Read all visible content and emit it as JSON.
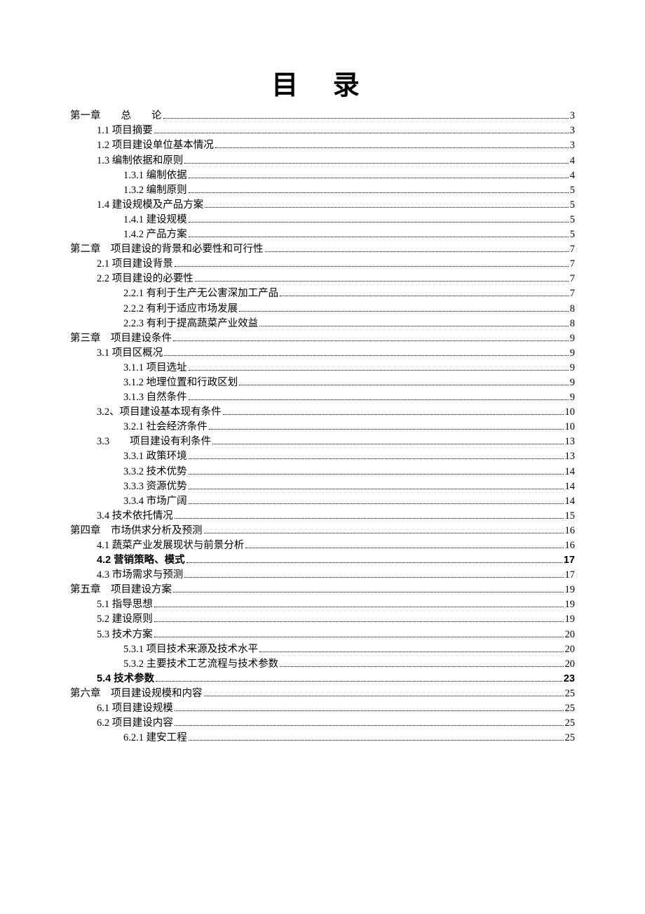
{
  "title": "目  录",
  "entries": [
    {
      "level": 1,
      "label": "第一章　　总　　论",
      "page": "3",
      "bold": false
    },
    {
      "level": 2,
      "label": "1.1 项目摘要",
      "page": "3",
      "bold": false
    },
    {
      "level": 2,
      "label": "1.2 项目建设单位基本情况",
      "page": "3",
      "bold": false
    },
    {
      "level": 2,
      "label": "1.3 编制依据和原则",
      "page": "4",
      "bold": false
    },
    {
      "level": 3,
      "label": "1.3.1 编制依据",
      "page": "4",
      "bold": false
    },
    {
      "level": 3,
      "label": "1.3.2 编制原则",
      "page": "5",
      "bold": false
    },
    {
      "level": 2,
      "label": "1.4 建设规模及产品方案",
      "page": "5",
      "bold": false
    },
    {
      "level": 3,
      "label": "1.4.1 建设规模",
      "page": "5",
      "bold": false
    },
    {
      "level": 3,
      "label": "1.4.2 产品方案",
      "page": "5",
      "bold": false
    },
    {
      "level": 1,
      "label": "第二章　项目建设的背景和必要性和可行性",
      "page": "7",
      "bold": false
    },
    {
      "level": 2,
      "label": "2.1 项目建设背景",
      "page": "7",
      "bold": false
    },
    {
      "level": 2,
      "label": "2.2 项目建设的必要性",
      "page": "7",
      "bold": false
    },
    {
      "level": 3,
      "label": "2.2.1 有利于生产无公害深加工产品",
      "page": "7",
      "bold": false
    },
    {
      "level": 3,
      "label": "2.2.2 有利于适应市场发展",
      "page": "8",
      "bold": false
    },
    {
      "level": 3,
      "label": "2.2.3 有利于提高蔬菜产业效益",
      "page": "8",
      "bold": false
    },
    {
      "level": 1,
      "label": "第三章　项目建设条件",
      "page": "9",
      "bold": false
    },
    {
      "level": 2,
      "label": "3.1 项目区概况",
      "page": "9",
      "bold": false
    },
    {
      "level": 3,
      "label": "3.1.1 项目选址",
      "page": "9",
      "bold": false
    },
    {
      "level": 3,
      "label": "3.1.2 地理位置和行政区划",
      "page": "9",
      "bold": false
    },
    {
      "level": 3,
      "label": "3.1.3 自然条件",
      "page": "9",
      "bold": false
    },
    {
      "level": 2,
      "label": "3.2、项目建设基本现有条件",
      "page": "10",
      "bold": false
    },
    {
      "level": 3,
      "label": "3.2.1 社会经济条件",
      "page": "10",
      "bold": false
    },
    {
      "level": 2,
      "label": "3.3　　项目建设有利条件",
      "page": "13",
      "bold": false
    },
    {
      "level": 3,
      "label": "3.3.1 政策环境",
      "page": "13",
      "bold": false
    },
    {
      "level": 3,
      "label": "3.3.2 技术优势",
      "page": "14",
      "bold": false
    },
    {
      "level": 3,
      "label": "3.3.3 资源优势",
      "page": "14",
      "bold": false
    },
    {
      "level": 3,
      "label": "3.3.4 市场广阔",
      "page": "14",
      "bold": false
    },
    {
      "level": 2,
      "label": "3.4 技术依托情况",
      "page": "15",
      "bold": false
    },
    {
      "level": 1,
      "label": "第四章　市场供求分析及预测",
      "page": "16",
      "bold": false
    },
    {
      "level": 2,
      "label": "4.1 蔬菜产业发展现状与前景分析",
      "page": "16",
      "bold": false
    },
    {
      "level": 2,
      "label": "4.2 营销策略、模式",
      "page": "17",
      "bold": true
    },
    {
      "level": 2,
      "label": "4.3 市场需求与预测",
      "page": "17",
      "bold": false
    },
    {
      "level": 1,
      "label": "第五章　项目建设方案",
      "page": "19",
      "bold": false
    },
    {
      "level": 2,
      "label": "5.1 指导思想",
      "page": "19",
      "bold": false
    },
    {
      "level": 2,
      "label": "5.2 建设原则",
      "page": "19",
      "bold": false
    },
    {
      "level": 2,
      "label": "5.3 技术方案",
      "page": "20",
      "bold": false
    },
    {
      "level": 3,
      "label": "5.3.1 项目技术来源及技术水平",
      "page": "20",
      "bold": false
    },
    {
      "level": 3,
      "label": "5.3.2 主要技术工艺流程与技术参数",
      "page": "20",
      "bold": false
    },
    {
      "level": 2,
      "label": "5.4 技术参数",
      "page": "23",
      "bold": true
    },
    {
      "level": 1,
      "label": "第六章　项目建设规模和内容",
      "page": "25",
      "bold": false
    },
    {
      "level": 2,
      "label": "6.1 项目建设规模",
      "page": "25",
      "bold": false
    },
    {
      "level": 2,
      "label": "6.2 项目建设内容",
      "page": "25",
      "bold": false
    },
    {
      "level": 3,
      "label": "6.2.1 建安工程",
      "page": "25",
      "bold": false
    }
  ]
}
